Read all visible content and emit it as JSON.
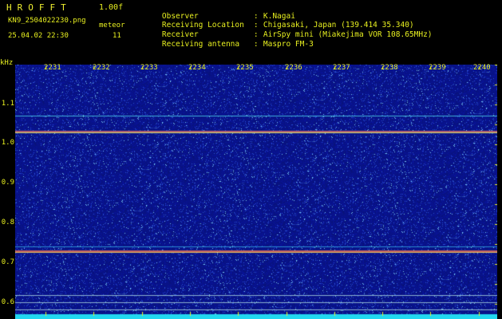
{
  "header": {
    "brand": "HROFFT",
    "version": "1.00f",
    "filename": "KN9_2504022230.png",
    "mode_label": "meteor",
    "datetime": "25.04.02 22:30",
    "count": "11"
  },
  "station": [
    {
      "key": "Observer",
      "value": "K.Nagai"
    },
    {
      "key": "Receiving Location",
      "value": "Chigasaki, Japan (139.414 35.340)"
    },
    {
      "key": "Receiver",
      "value": "AirSpy mini (Miakejima VOR 108.65MHz)"
    },
    {
      "key": "Receiving antenna",
      "value": "Maspro FM-3"
    }
  ],
  "spectrogram": {
    "y_unit": "kHz",
    "y_ticks": [
      "1.1",
      "1.0",
      "0.9",
      "0.8",
      "0.7",
      "0.6"
    ],
    "x_ticks": [
      "2231",
      "2232",
      "2233",
      "2234",
      "2235",
      "2236",
      "2237",
      "2238",
      "2239",
      "2240"
    ]
  },
  "colors": {
    "text": "#e8f020",
    "background": "#000000",
    "noise_base": "#08128a",
    "baseline": "#22d8f0"
  }
}
